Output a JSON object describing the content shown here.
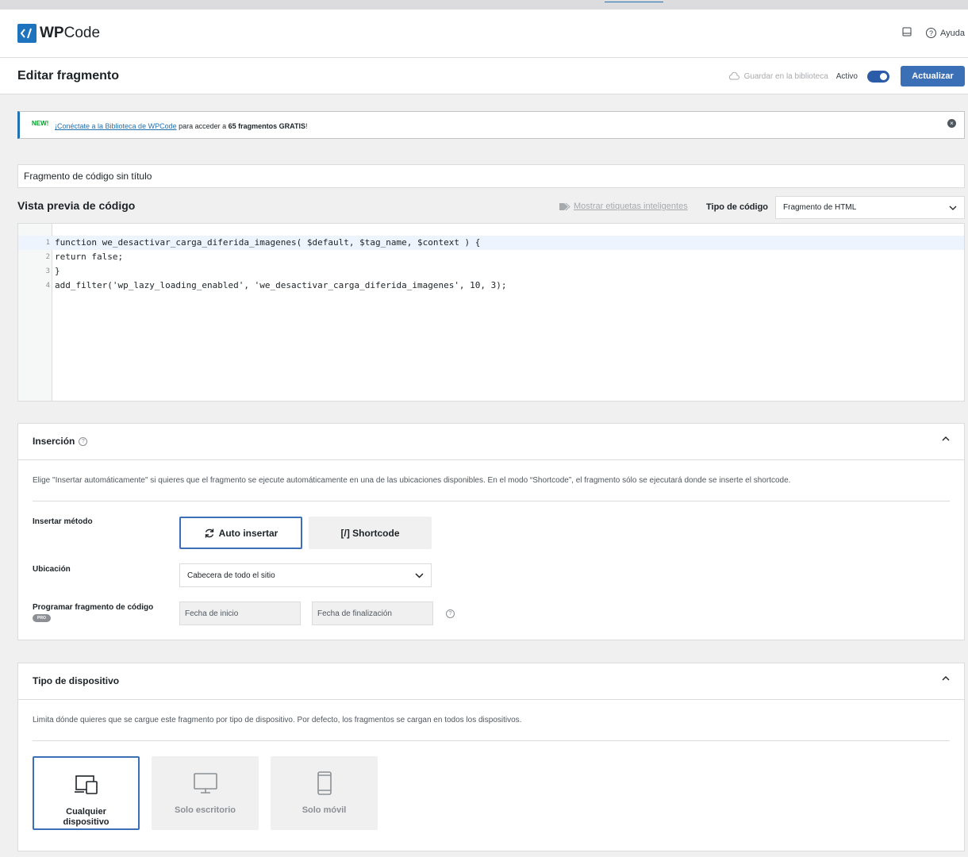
{
  "header": {
    "logo_wp": "WP",
    "logo_code": "Code",
    "help_label": "Ayuda"
  },
  "titlebar": {
    "title": "Editar fragmento",
    "save_library_label": "Guardar en la biblioteca",
    "active_label": "Activo",
    "update_label": "Actualizar",
    "active_on": true
  },
  "notice": {
    "badge": "NEW!",
    "link_text": "¡Conéctate a la Biblioteca de WPCode",
    "middle_text": " para acceder a ",
    "bold_text": "65 fragmentos GRATIS",
    "end_text": "!"
  },
  "snippet": {
    "title_value": "Fragmento de código sin título"
  },
  "code_preview": {
    "title": "Vista previa de código",
    "smart_tags_label": "Mostrar etiquetas inteligentes",
    "code_type_label": "Tipo de código",
    "code_type_value": "Fragmento de HTML",
    "lines": [
      {
        "n": "1",
        "text": "function we_desactivar_carga_diferida_imagenes( $default, $tag_name, $context ) {"
      },
      {
        "n": "2",
        "text": "return false;"
      },
      {
        "n": "3",
        "text": "}"
      },
      {
        "n": "4",
        "text": "add_filter('wp_lazy_loading_enabled', 'we_desactivar_carga_diferida_imagenes', 10, 3);"
      }
    ]
  },
  "insertion": {
    "title": "Inserción",
    "description": "Elige \"Insertar automáticamente\" si quieres que el fragmento se ejecute automáticamente en una de las ubicaciones disponibles. En el modo “Shortcode”, el fragmento sólo se ejecutará donde se inserte el shortcode.",
    "method_label": "Insertar método",
    "auto_insert_label": "Auto insertar",
    "shortcode_label": "[/] Shortcode",
    "location_label": "Ubicación",
    "location_value": "Cabecera de todo el sitio",
    "schedule_label": "Programar fragmento de código",
    "pro_badge": "PRO",
    "start_date_placeholder": "Fecha de inicio",
    "end_date_placeholder": "Fecha de finalización"
  },
  "device": {
    "title": "Tipo de dispositivo",
    "description": "Limita dónde quieres que se cargue este fragmento por tipo de dispositivo. Por defecto, los fragmentos se cargan en todos los dispositivos.",
    "options": [
      {
        "label": "Cualquier dispositivo",
        "icon": "devices-icon",
        "selected": true
      },
      {
        "label": "Solo escritorio",
        "icon": "desktop-icon",
        "selected": false
      },
      {
        "label": "Solo móvil",
        "icon": "mobile-icon",
        "selected": false
      }
    ]
  },
  "colors": {
    "accent": "#3b6fb6",
    "new_badge": "#00a32a",
    "link": "#2271b1"
  }
}
